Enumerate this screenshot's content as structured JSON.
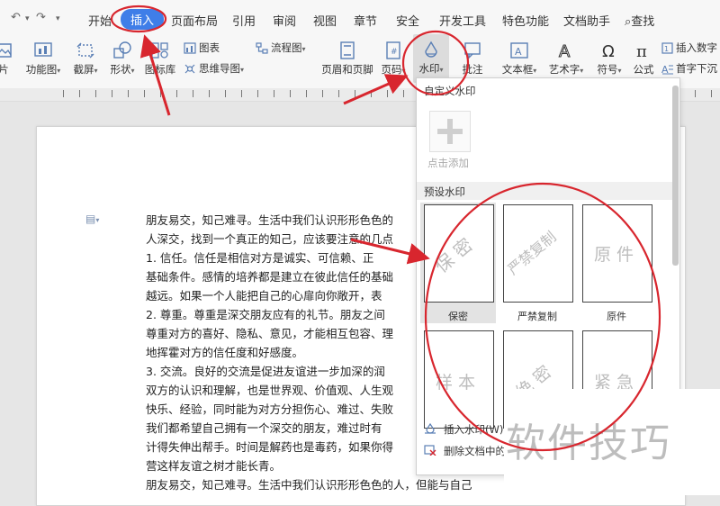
{
  "menubar": {
    "quick_icons": [
      "undo-icon",
      "redo-icon",
      "more-caret-icon"
    ],
    "tabs": [
      "开始",
      "插入",
      "页面布局",
      "引用",
      "审阅",
      "视图",
      "章节",
      "安全",
      "开发工具",
      "特色功能",
      "文档助手"
    ],
    "active_tab": "插入",
    "search_label": "查找"
  },
  "ribbon": {
    "picture_label": "片",
    "feature_chart": "功能图",
    "screenshot": "截屏",
    "shapes": "形状",
    "icon_lib": "图标库",
    "chart": "图表",
    "mindmap": "思维导图",
    "flowchart": "流程图",
    "header_footer": "页眉和页脚",
    "page_number": "页码",
    "watermark": "水印",
    "comment": "批注",
    "textbox": "文本框",
    "wordart": "艺术字",
    "symbol": "符号",
    "formula": "公式",
    "insert_number": "插入数字",
    "drop_cap": "首字下沉"
  },
  "document": {
    "lines": [
      "朋友易交，知己难寻。生活中我们认识形形色色的",
      "人深交，找到一个真正的知己，应该要注意的几点",
      "1.  信任。信任是相信对方是诚实、可信赖、正",
      "基础条件。感情的培养都是建立在彼此信任的基础",
      "越远。如果一个人能把自己的心扉向你敞开，表",
      "2.  尊重。尊重是深交朋友应有的礼节。朋友之间",
      "尊重对方的喜好、隐私、意见，才能相互包容、理",
      "地挥霍对方的信任度和好感度。",
      "3.  交流。良好的交流是促进友谊进一步加深的润",
      "双方的认识和理解，也是世界观、价值观、人生观",
      "快乐、经验，同时能为对方分担伤心、难过、失败",
      "    我们都希望自己拥有一个深交的朋友，难过时有",
      "计得失伸出帮手。时间是解药也是毒药，如果你得",
      "营这样友谊之树才能长青。",
      "朋友易交，知己难寻。生活中我们认识形形色色的人，但能与自己"
    ]
  },
  "watermark_menu": {
    "custom_title": "自定义水印",
    "add_label": "点击添加",
    "preset_title": "预设水印",
    "presets": [
      {
        "name": "保密",
        "text": "保 密"
      },
      {
        "name": "严禁复制",
        "text": "严禁复制"
      },
      {
        "name": "原件",
        "text": "原 件"
      },
      {
        "name": "",
        "text": "样 本"
      },
      {
        "name": "",
        "text": "绝 密"
      },
      {
        "name": "",
        "text": "紧 急"
      }
    ],
    "selected": "保密",
    "insert_label": "插入水印(W)...",
    "delete_label": "删除文档中的"
  },
  "brand_watermark": "软件技巧",
  "colors": {
    "accent": "#3f7ee8",
    "annotation": "#d8262e"
  }
}
